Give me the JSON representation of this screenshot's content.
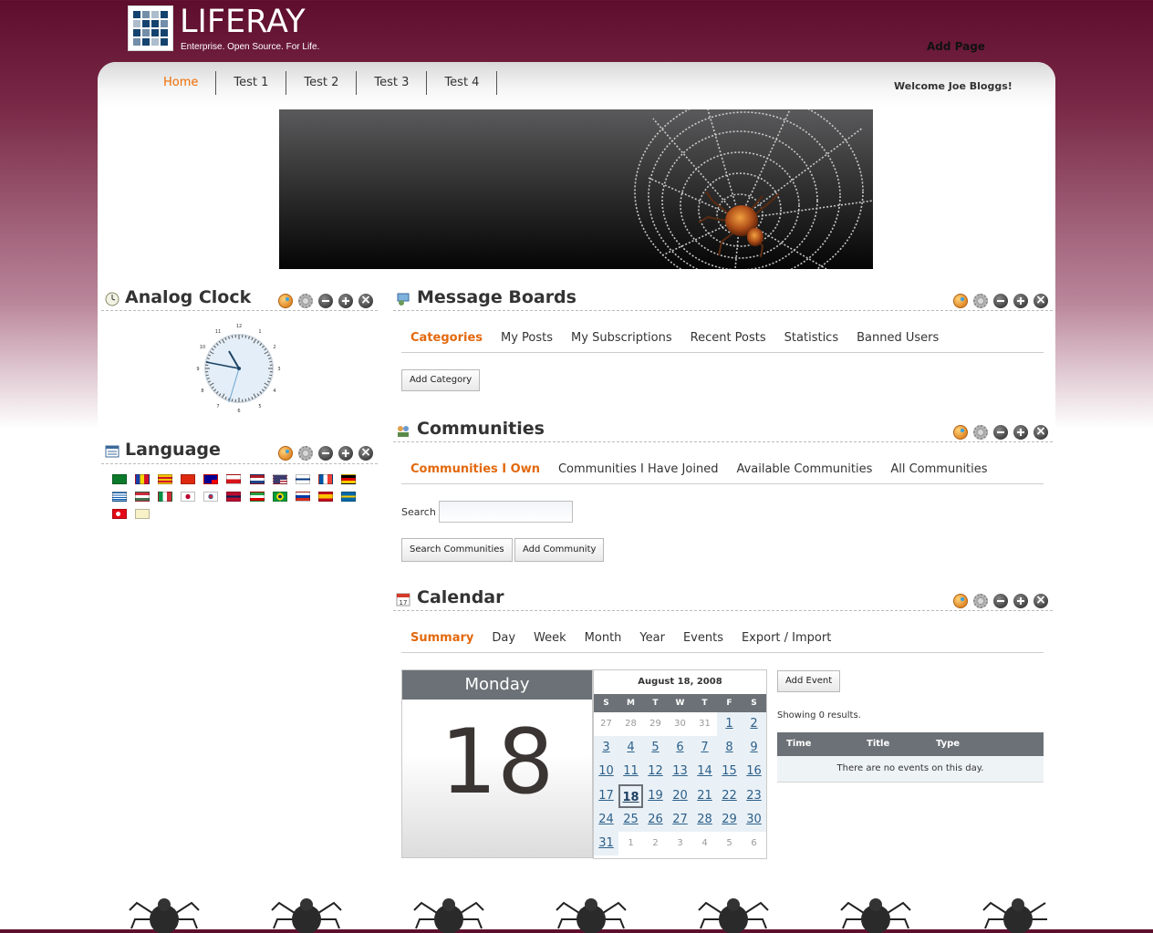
{
  "header": {
    "logo_text": "LIFERAY",
    "logo_tagline": "Enterprise. Open Source. For Life.",
    "add_page": "Add Page",
    "welcome": "Welcome Joe Bloggs!"
  },
  "nav": {
    "tabs": [
      "Home",
      "Test 1",
      "Test 2",
      "Test 3",
      "Test 4"
    ],
    "active": "Home"
  },
  "clock_portlet": {
    "title": "Analog Clock"
  },
  "language_portlet": {
    "title": "Language",
    "flags": [
      "ar_SA",
      "ca_AD",
      "ca_ES",
      "zh_CN",
      "zh_TW",
      "cs_CZ",
      "nl_NL",
      "en_US",
      "fi_FI",
      "fr_FR",
      "de_DE",
      "el_GR",
      "hu_HU",
      "it_IT",
      "ja_JP",
      "ko_KR",
      "nb_NO",
      "fa_IR",
      "pt_BR",
      "ru_RU",
      "es_ES",
      "sv_SE",
      "tr_TR",
      "vi_VN"
    ]
  },
  "message_boards": {
    "title": "Message Boards",
    "tabs": [
      "Categories",
      "My Posts",
      "My Subscriptions",
      "Recent Posts",
      "Statistics",
      "Banned Users"
    ],
    "add_category": "Add Category"
  },
  "communities": {
    "title": "Communities",
    "tabs": [
      "Communities I Own",
      "Communities I Have Joined",
      "Available Communities",
      "All Communities"
    ],
    "search_label": "Search",
    "search_value": "",
    "search_button": "Search Communities",
    "add_button": "Add Community"
  },
  "calendar": {
    "title": "Calendar",
    "tabs": [
      "Summary",
      "Day",
      "Week",
      "Month",
      "Year",
      "Events",
      "Export / Import"
    ],
    "day_name": "Monday",
    "day_number": "18",
    "month_title": "August 18, 2008",
    "weekdays": [
      "S",
      "M",
      "T",
      "W",
      "T",
      "F",
      "S"
    ],
    "days": [
      "27",
      "28",
      "29",
      "30",
      "31",
      "1",
      "2",
      "3",
      "4",
      "5",
      "6",
      "7",
      "8",
      "9",
      "10",
      "11",
      "12",
      "13",
      "14",
      "15",
      "16",
      "17",
      "18",
      "19",
      "20",
      "21",
      "22",
      "23",
      "24",
      "25",
      "26",
      "27",
      "28",
      "29",
      "30",
      "31",
      "1",
      "2",
      "3",
      "4",
      "5",
      "6"
    ],
    "add_event": "Add Event",
    "showing": "Showing 0 results.",
    "columns": [
      "Time",
      "Title",
      "Type"
    ],
    "empty_message": "There are no events on this day."
  },
  "colors": {
    "accent": "#e3690e",
    "header_dark": "#5e0d2c",
    "table_header": "#6b7176",
    "link": "#2b5f8a"
  }
}
